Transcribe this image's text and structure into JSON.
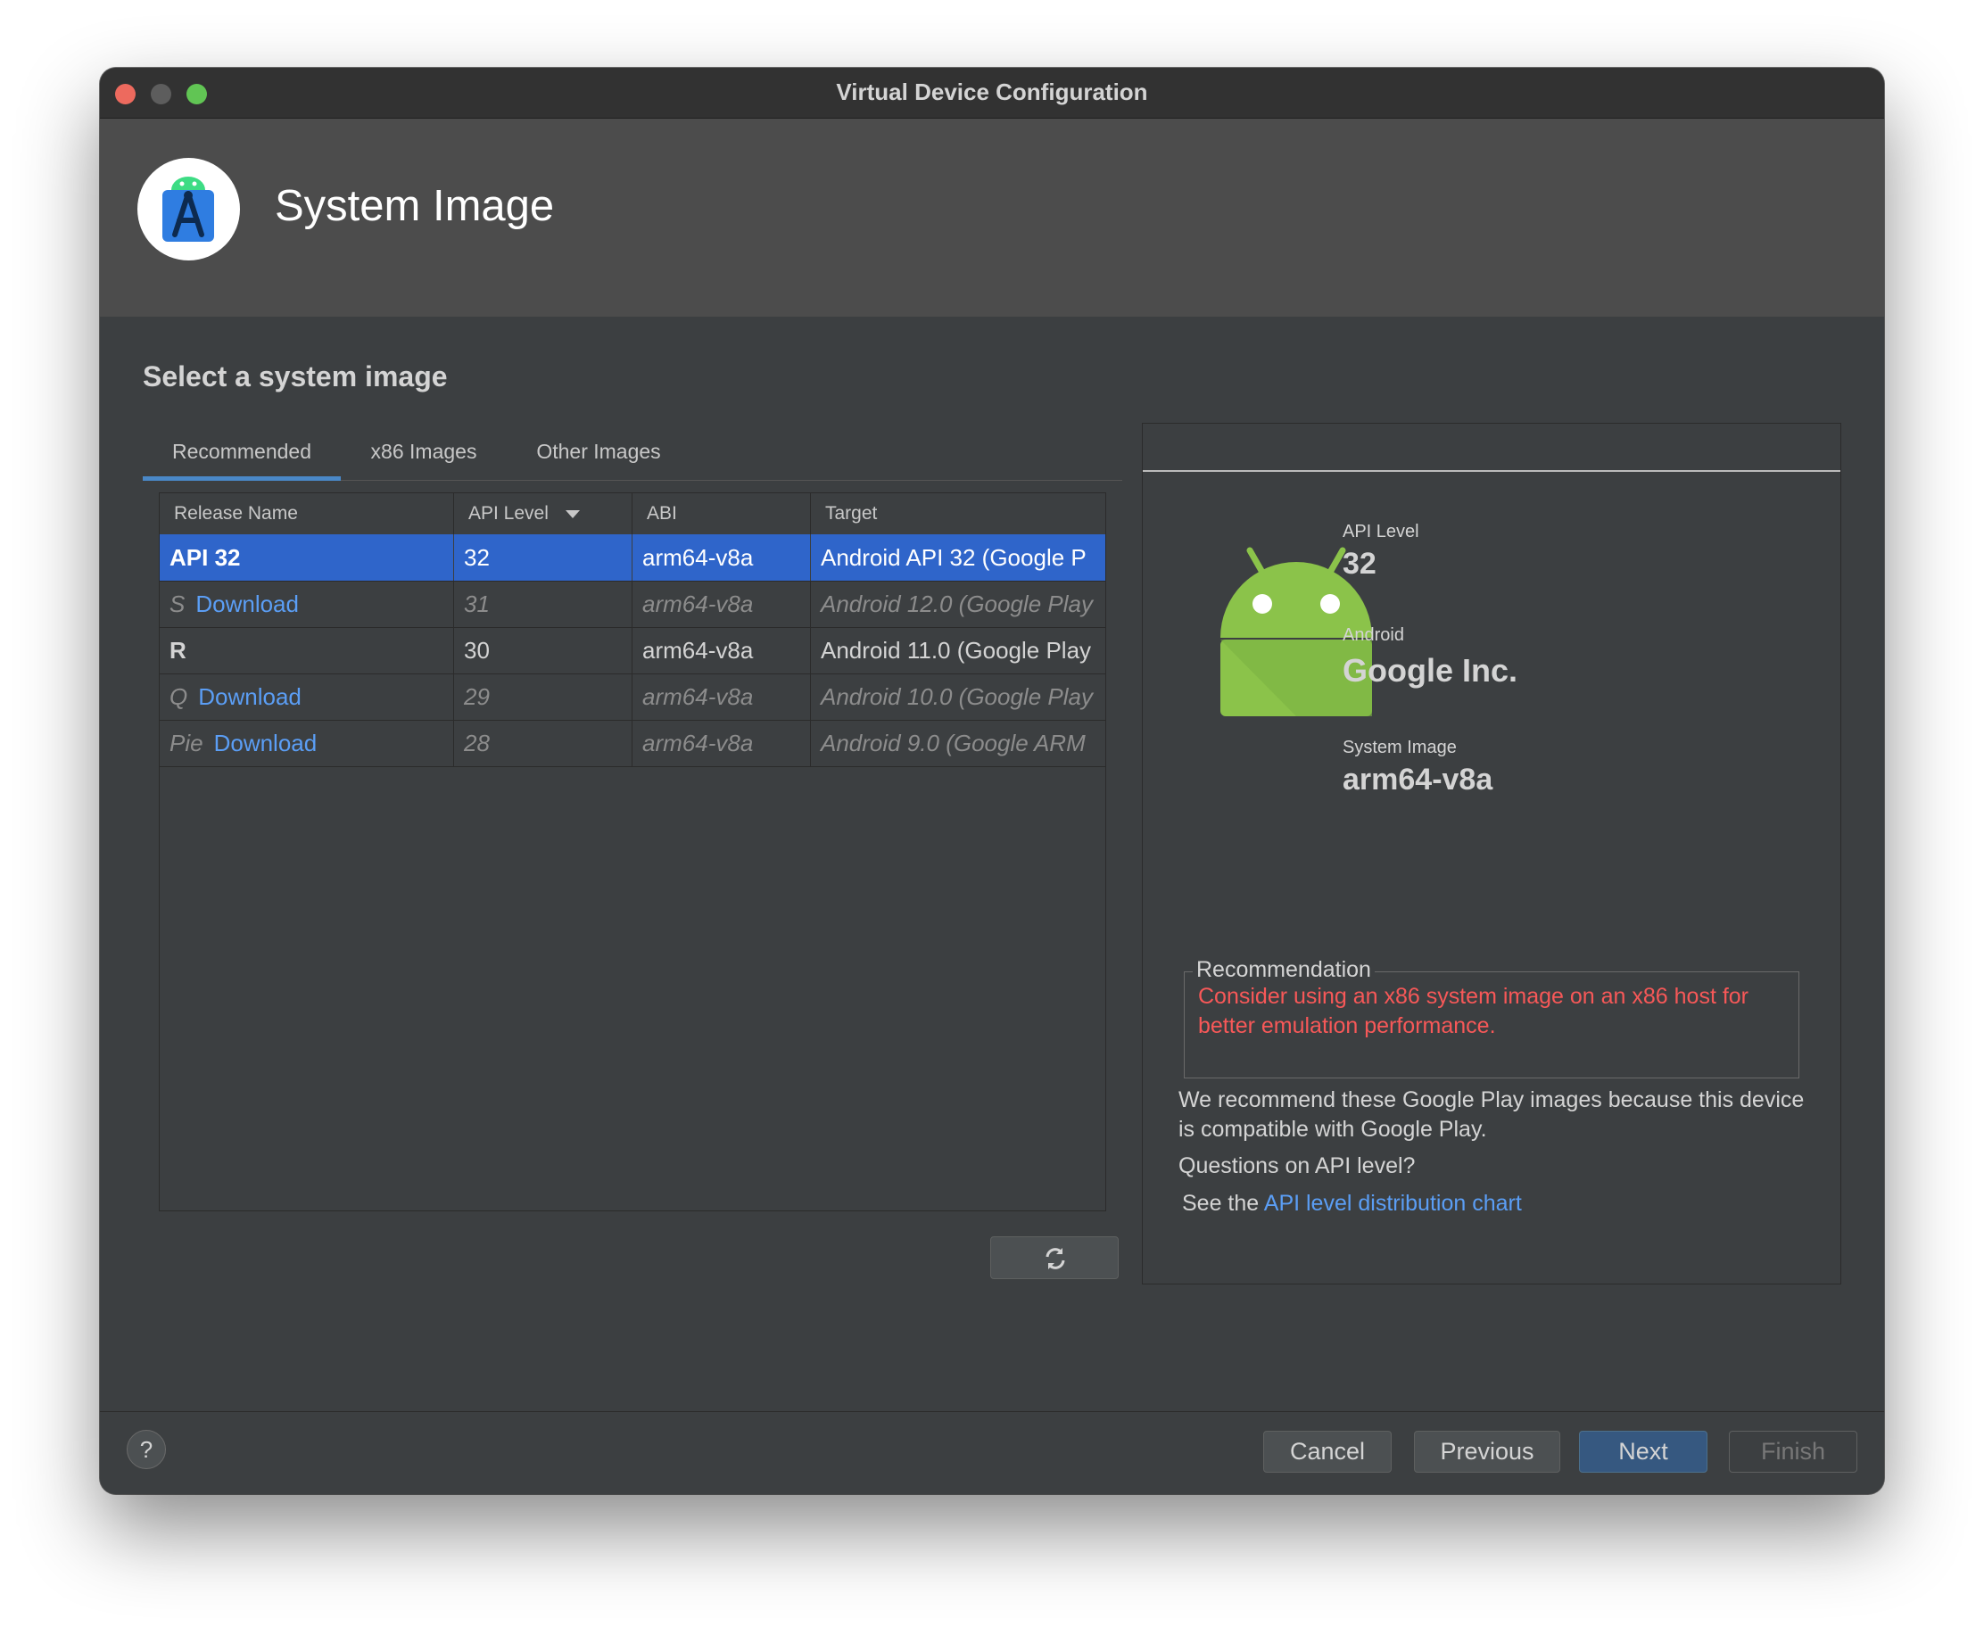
{
  "window": {
    "title": "Virtual Device Configuration"
  },
  "header": {
    "title": "System Image",
    "logo_icon": "android-studio-icon"
  },
  "section_title": "Select a system image",
  "tabs": [
    {
      "label": "Recommended",
      "active": true
    },
    {
      "label": "x86 Images",
      "active": false
    },
    {
      "label": "Other Images",
      "active": false
    }
  ],
  "table": {
    "columns": [
      "Release Name",
      "API Level",
      "ABI",
      "Target"
    ],
    "sort_icon": "sort-descending-icon",
    "rows": [
      {
        "release": "API 32",
        "download": "",
        "api": "32",
        "abi": "arm64-v8a",
        "target": "Android API 32 (Google P",
        "selected": true
      },
      {
        "release": "S",
        "download": "Download",
        "api": "31",
        "abi": "arm64-v8a",
        "target": "Android 12.0 (Google Play",
        "selected": false
      },
      {
        "release": "R",
        "download": "",
        "api": "30",
        "abi": "arm64-v8a",
        "target": "Android 11.0 (Google Play",
        "selected": false
      },
      {
        "release": "Q",
        "download": "Download",
        "api": "29",
        "abi": "arm64-v8a",
        "target": "Android 10.0 (Google Play",
        "selected": false
      },
      {
        "release": "Pie",
        "download": "Download",
        "api": "28",
        "abi": "arm64-v8a",
        "target": "Android 9.0 (Google ARM",
        "selected": false
      }
    ]
  },
  "refresh_icon": "refresh-icon",
  "details": {
    "api_level_label": "API Level",
    "api_level_value": "32",
    "android_label": "Android",
    "android_value": "Google Inc.",
    "system_image_label": "System Image",
    "system_image_value": "arm64-v8a",
    "image_icon": "android-robot-icon"
  },
  "recommendation": {
    "title": "Recommendation",
    "warning": "Consider using an x86 system image on an x86 host for better emulation performance."
  },
  "note": "We recommend these Google Play images because this device is compatible with Google Play.",
  "question": "Questions on API level?",
  "see_the": "See the",
  "link": "API level distribution chart",
  "footer": {
    "help": "?",
    "cancel": "Cancel",
    "previous": "Previous",
    "next": "Next",
    "finish": "Finish"
  },
  "colors": {
    "accent": "#4a88c7",
    "selection": "#2f65ca",
    "link": "#5b9ef5",
    "warning": "#f75858",
    "android_green": "#8bc34a"
  }
}
